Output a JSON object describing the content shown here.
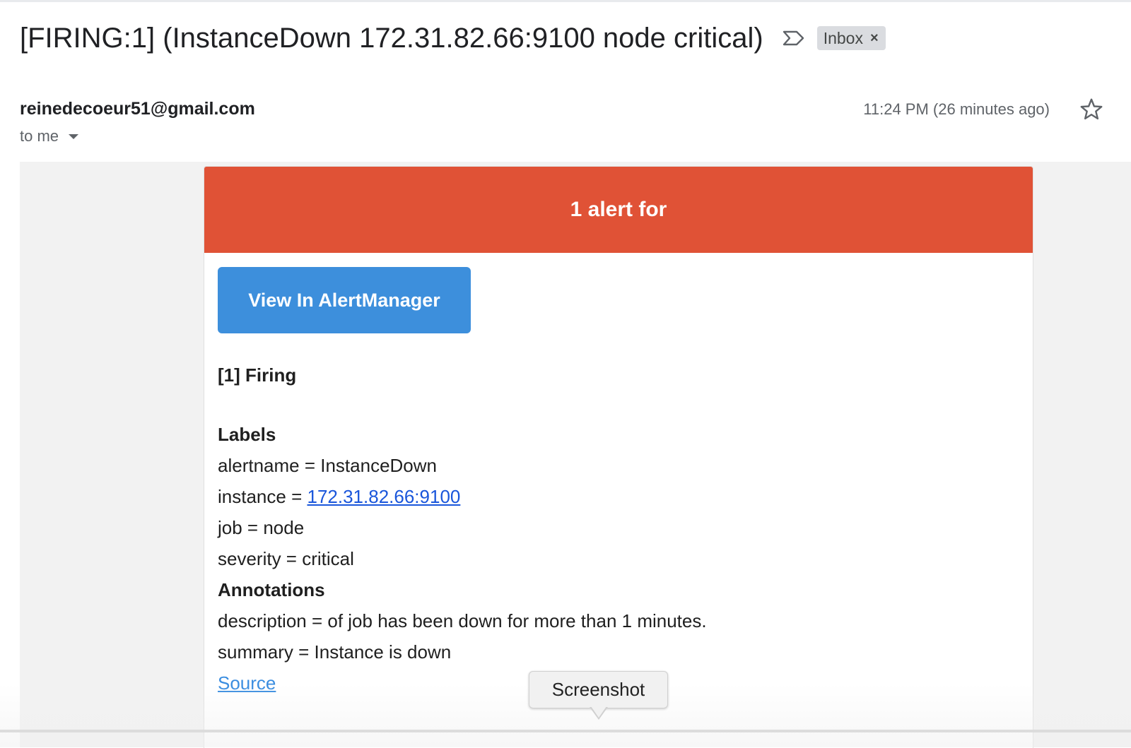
{
  "email": {
    "subject": "[FIRING:1] (InstanceDown 172.31.82.66:9100 node critical)",
    "label_chip": "Inbox",
    "label_remove": "×",
    "sender": "reinedecoeur51@gmail.com",
    "recipient": "to me",
    "timestamp": "11:24 PM (26 minutes ago)"
  },
  "alert": {
    "header": "1 alert for",
    "button_label": "View In AlertManager",
    "firing_title": "[1] Firing",
    "labels_heading": "Labels",
    "label_lines": {
      "alertname": "alertname = InstanceDown",
      "instance_prefix": "instance = ",
      "instance_value": "172.31.82.66:9100",
      "job": "job = node",
      "severity": "severity = critical"
    },
    "annotations_heading": "Annotations",
    "annotation_lines": {
      "description": "description = of job has been down for more than 1 minutes.",
      "summary": "summary = Instance is down"
    },
    "source_link": "Source"
  },
  "tooltip": "Screenshot",
  "colors": {
    "header_bg": "#e05236",
    "button_bg": "#3d8fdc",
    "link": "#1a56db"
  },
  "icons": [
    "importance-marker-icon",
    "star-icon",
    "dropdown-caret-icon"
  ]
}
